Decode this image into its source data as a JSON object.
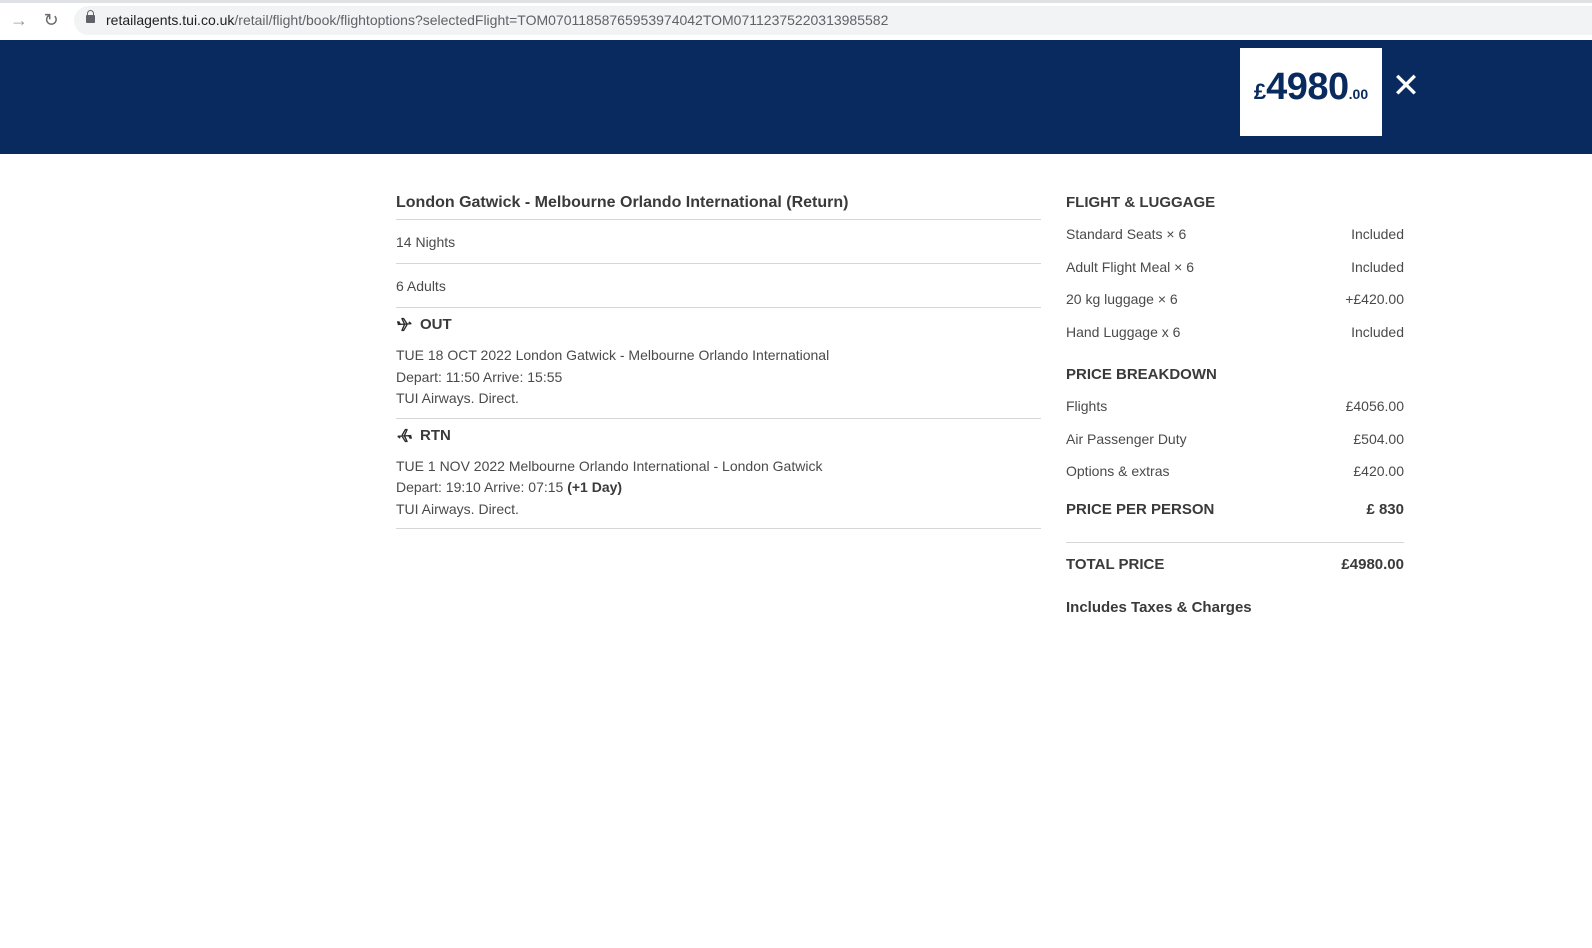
{
  "browser": {
    "url_host": "retailagents.tui.co.uk",
    "url_path": "/retail/flight/book/flightoptions?selectedFlight=TOM07011858765953974042TOM07112375220313985582"
  },
  "header": {
    "price_currency": "£",
    "price_main": "4980",
    "price_decimals": ".00",
    "close_icon": "close-icon",
    "background_color": "#092a5e"
  },
  "details": {
    "route_title": "London Gatwick - Melbourne Orlando International (Return)",
    "nights": "14 Nights",
    "passengers": "6  Adults",
    "outbound": {
      "label": "OUT",
      "line1": "TUE 18 OCT 2022 London Gatwick  - Melbourne Orlando International",
      "line2": "Depart: 11:50 Arrive: 15:55",
      "line3": "TUI Airways. Direct."
    },
    "return": {
      "label": "RTN",
      "line1": "TUE 1 NOV 2022 Melbourne Orlando International  - London Gatwick",
      "line2": "Depart: 19:10 Arrive: 07:15 ",
      "line2_bold": "(+1 Day)",
      "line3": "TUI Airways. Direct."
    }
  },
  "summary": {
    "flight_luggage_heading": "FLIGHT & LUGGAGE",
    "extras": [
      {
        "label": "Standard Seats × 6",
        "value": "Included"
      },
      {
        "label": "Adult Flight Meal × 6",
        "value": "Included"
      },
      {
        "label": "20 kg luggage × 6",
        "value": "+£420.00"
      },
      {
        "label": "Hand Luggage x 6",
        "value": "Included"
      }
    ],
    "price_breakdown_heading": "PRICE BREAKDOWN",
    "breakdown": [
      {
        "label": "Flights",
        "value": "£4056.00"
      },
      {
        "label": "Air Passenger Duty",
        "value": "£504.00"
      },
      {
        "label": "Options & extras",
        "value": "£420.00"
      }
    ],
    "per_person_label": "PRICE PER PERSON",
    "per_person_value": "£ 830",
    "total_label": "TOTAL PRICE",
    "total_value": "£4980.00",
    "taxes_note": "Includes Taxes & Charges"
  }
}
